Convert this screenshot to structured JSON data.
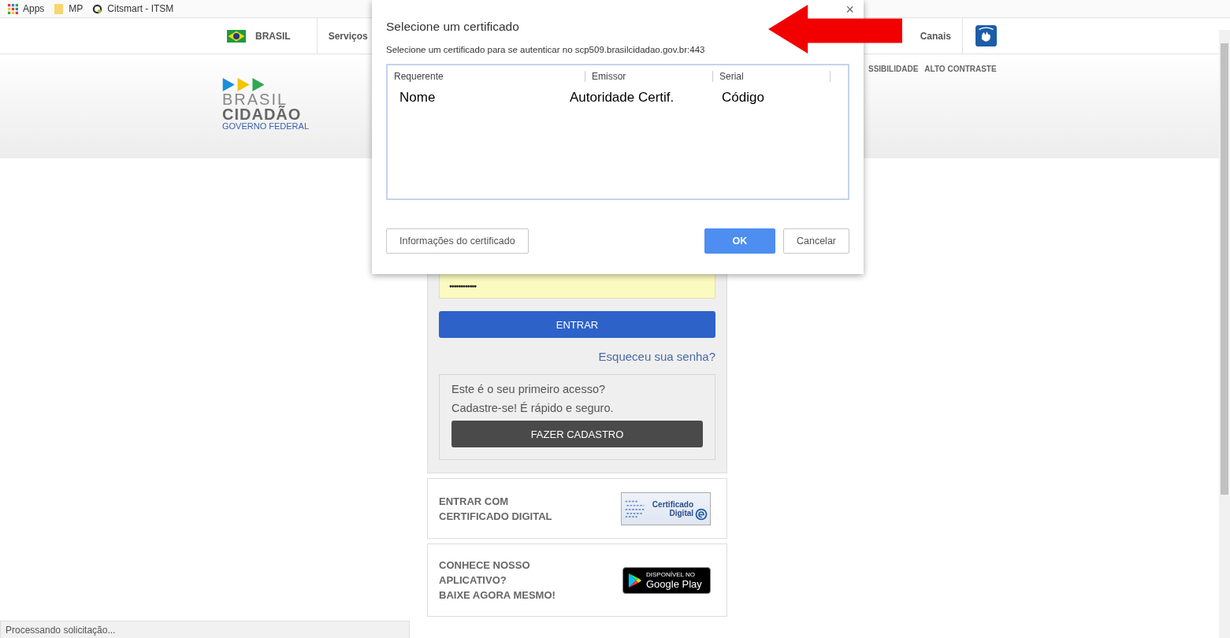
{
  "bookmarks": [
    {
      "label": "Apps",
      "kind": "apps"
    },
    {
      "label": "MP",
      "kind": "folder"
    },
    {
      "label": "Citsmart - ITSM",
      "kind": "site"
    }
  ],
  "gov_bar": {
    "brand": "BRASIL",
    "left_links": [
      "Serviços"
    ],
    "right_links": [
      "Canais"
    ]
  },
  "header": {
    "logo_top": "BRASIL",
    "logo_bottom": "CIDADÃO",
    "logo_sub": "GOVERNO FEDERAL",
    "links": [
      "SSIBILIDADE",
      "ALTO CONTRASTE"
    ]
  },
  "login": {
    "password": {
      "value": "••••••••••••"
    },
    "enter_button": "ENTRAR",
    "forgot_link": "Esqueceu sua senha?",
    "signup": {
      "lines": [
        "Este é o seu primeiro acesso?",
        "Cadastre-se! É rápido e seguro."
      ],
      "button": "FAZER CADASTRO"
    }
  },
  "cert_card": {
    "lines": [
      "ENTRAR COM",
      "CERTIFICADO DIGITAL"
    ],
    "badge": [
      "Certificado",
      "Digital"
    ]
  },
  "app_card": {
    "lines": [
      "CONHECE NOSSO",
      "APLICATIVO?",
      "BAIXE AGORA MESMO!"
    ],
    "store_badge": {
      "small": "DISPONÍVEL NO",
      "big": "Google Play"
    }
  },
  "status_bar": "Processando solicitação...",
  "dialog": {
    "title": "Selecione um certificado",
    "message": "Selecione um certificado para se autenticar no scp509.brasilcidadao.gov.br:443",
    "close": "×",
    "columns": [
      "Requerente",
      "Emissor",
      "Serial"
    ],
    "rows": [
      {
        "cells": [
          "Nome",
          "Autoridade Certif.",
          "Código"
        ]
      }
    ],
    "buttons": [
      {
        "label": "Informações do certificado",
        "kind": "secondary"
      },
      {
        "label": "OK",
        "kind": "primary"
      },
      {
        "label": "Cancelar",
        "kind": "secondary"
      }
    ]
  }
}
